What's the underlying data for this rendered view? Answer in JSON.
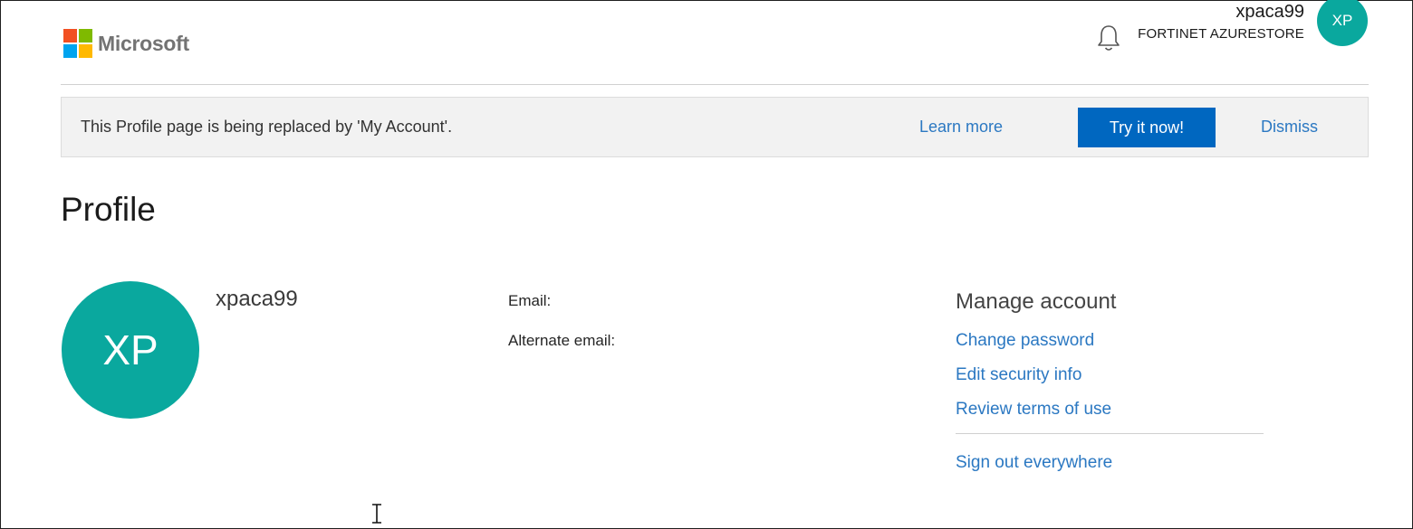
{
  "header": {
    "brand": "Microsoft",
    "logo_colors": [
      "#f25022",
      "#7fba00",
      "#00a4ef",
      "#ffb900"
    ],
    "notification_icon": "bell-icon",
    "user_name": "xpaca99",
    "organization": "FORTINET AZURESTORE",
    "avatar_initials": "XP"
  },
  "banner": {
    "message": "This Profile page is being replaced by 'My Account'.",
    "learn_more": "Learn more",
    "try_button": "Try it now!",
    "dismiss": "Dismiss"
  },
  "page": {
    "title": "Profile"
  },
  "profile": {
    "avatar_initials": "XP",
    "name": "xpaca99",
    "email_label": "Email:",
    "alternate_email_label": "Alternate email:"
  },
  "manage": {
    "title": "Manage account",
    "links": [
      "Change password",
      "Edit security info",
      "Review terms of use"
    ],
    "sign_out": "Sign out everywhere"
  },
  "colors": {
    "accent_teal": "#0aa89e",
    "primary_blue": "#0067c0",
    "link_blue": "#2b78c2",
    "banner_bg": "#f2f2f2"
  }
}
